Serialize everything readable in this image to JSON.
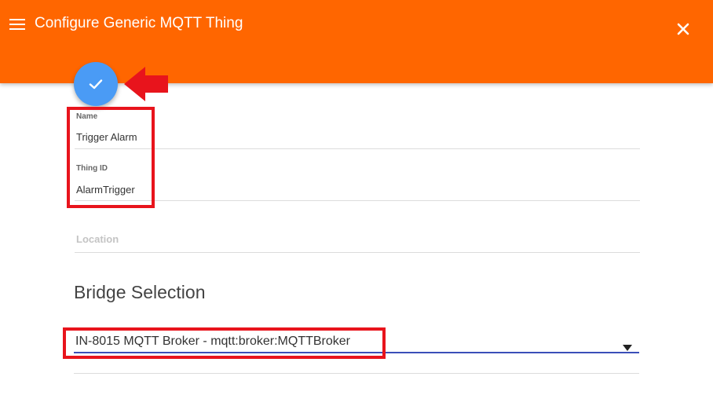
{
  "header": {
    "title": "Configure Generic MQTT Thing",
    "menu_icon": "hamburger-menu-icon",
    "close_icon": "close-icon",
    "background_color": "#ff6600"
  },
  "fab": {
    "icon": "checkmark-icon",
    "color": "#4a9bf5"
  },
  "annotations": {
    "highlight_color": "#e8141c",
    "arrow_icon": "red-arrow-left-icon"
  },
  "form": {
    "name": {
      "label": "Name",
      "value": "Trigger Alarm"
    },
    "thing_id": {
      "label": "Thing ID",
      "value": "AlarmTrigger"
    },
    "location": {
      "placeholder": "Location"
    }
  },
  "bridge": {
    "section_title": "Bridge Selection",
    "selected": "IN-8015 MQTT Broker - mqtt:broker:MQTTBroker",
    "underline_color": "#3b4fb8"
  }
}
